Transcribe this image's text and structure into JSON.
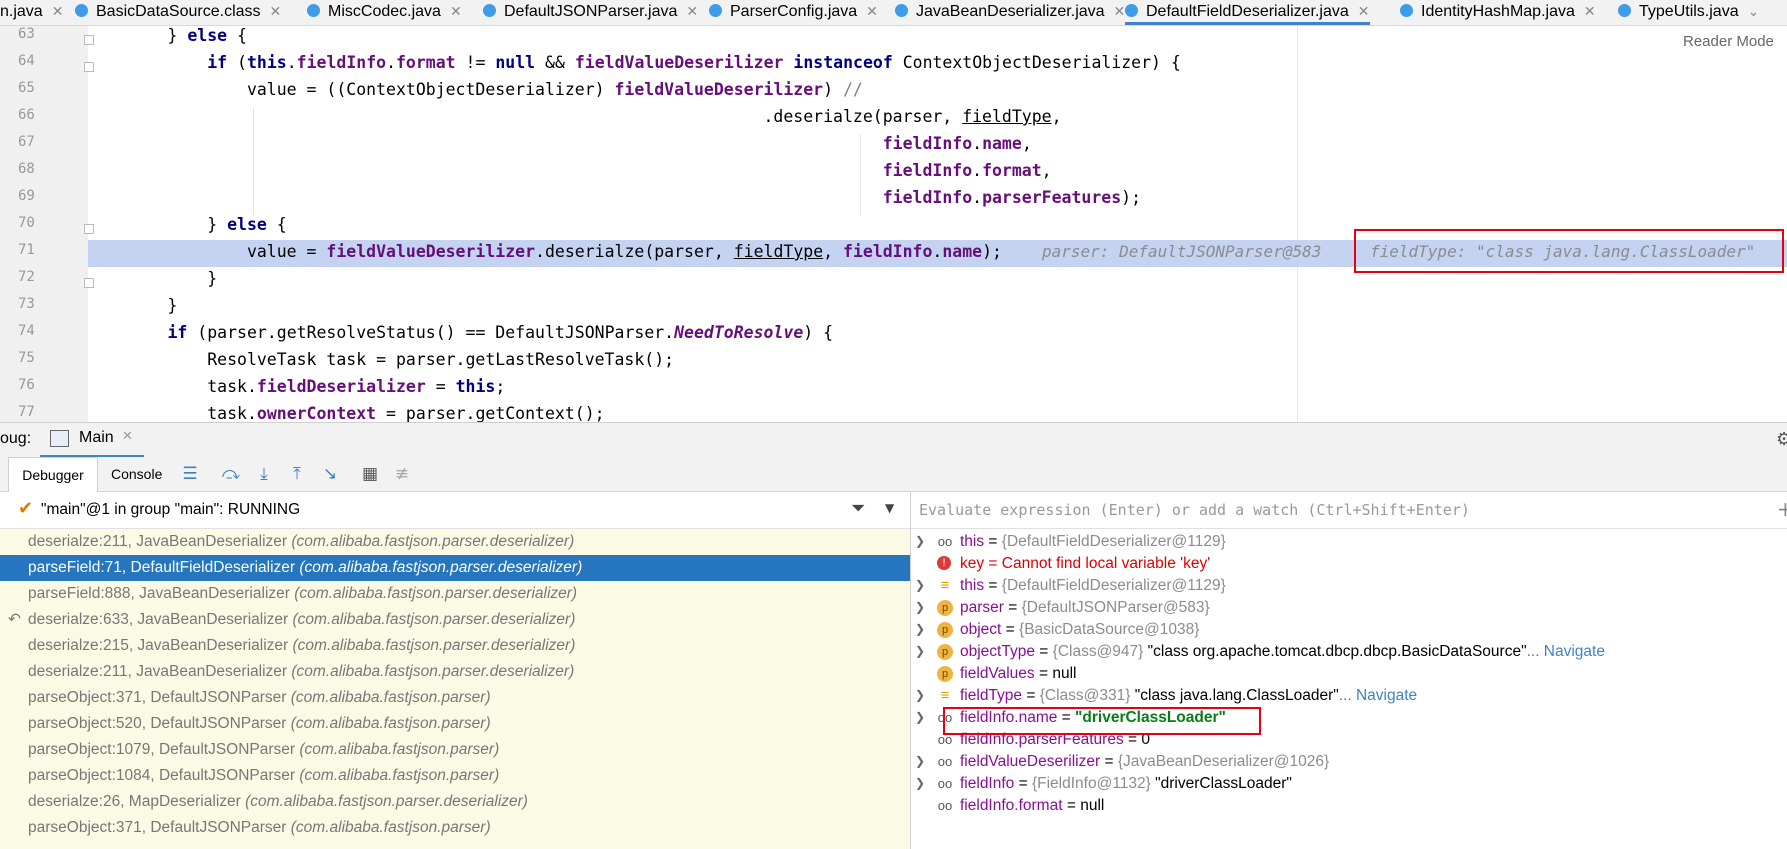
{
  "tabs": [
    {
      "label": "n.java"
    },
    {
      "label": "BasicDataSource.class"
    },
    {
      "label": "MiscCodec.java"
    },
    {
      "label": "DefaultJSONParser.java"
    },
    {
      "label": "ParserConfig.java"
    },
    {
      "label": "JavaBeanDeserializer.java"
    },
    {
      "label": "DefaultFieldDeserializer.java"
    },
    {
      "label": "IdentityHashMap.java"
    },
    {
      "label": "TypeUtils.java"
    }
  ],
  "reader_mode": "Reader Mode",
  "editor": {
    "line_numbers": [
      "63",
      "64",
      "65",
      "66",
      "67",
      "68",
      "69",
      "70",
      "71",
      "72",
      "73",
      "74",
      "75",
      "76",
      "77"
    ],
    "inline_hint_parser": "parser: DefaultJSONParser@583",
    "inline_hint_fieldtype": "fieldType: \"class java.lang.ClassLoader\""
  },
  "debug": {
    "label": "oug:",
    "session_tab": "Main",
    "debugger_tab": "Debugger",
    "console_tab": "Console",
    "thread_status": "\"main\"@1 in group \"main\": RUNNING",
    "eval_placeholder": "Evaluate expression (Enter) or add a watch (Ctrl+Shift+Enter)"
  },
  "frames": [
    {
      "method": "deserialze:211, JavaBeanDeserializer",
      "pkg": "(com.alibaba.fastjson.parser.deserializer)"
    },
    {
      "method": "parseField:71, DefaultFieldDeserializer",
      "pkg": "(com.alibaba.fastjson.parser.deserializer)"
    },
    {
      "method": "parseField:888, JavaBeanDeserializer",
      "pkg": "(com.alibaba.fastjson.parser.deserializer)"
    },
    {
      "method": "deserialze:633, JavaBeanDeserializer",
      "pkg": "(com.alibaba.fastjson.parser.deserializer)"
    },
    {
      "method": "deserialze:215, JavaBeanDeserializer",
      "pkg": "(com.alibaba.fastjson.parser.deserializer)"
    },
    {
      "method": "deserialze:211, JavaBeanDeserializer",
      "pkg": "(com.alibaba.fastjson.parser.deserializer)"
    },
    {
      "method": "parseObject:371, DefaultJSONParser",
      "pkg": "(com.alibaba.fastjson.parser)"
    },
    {
      "method": "parseObject:520, DefaultJSONParser",
      "pkg": "(com.alibaba.fastjson.parser)"
    },
    {
      "method": "parseObject:1079, DefaultJSONParser",
      "pkg": "(com.alibaba.fastjson.parser)"
    },
    {
      "method": "parseObject:1084, DefaultJSONParser",
      "pkg": "(com.alibaba.fastjson.parser)"
    },
    {
      "method": "deserialze:26, MapDeserializer",
      "pkg": "(com.alibaba.fastjson.parser.deserializer)"
    },
    {
      "method": "parseObject:371, DefaultJSONParser",
      "pkg": "(com.alibaba.fastjson.parser)"
    }
  ],
  "variables": [
    {
      "name": "this",
      "eq": " = ",
      "type": "{DefaultFieldDeserializer@1129}",
      "val": "",
      "nav": ""
    },
    {
      "name": "key",
      "eq": " = ",
      "type": "",
      "val": "Cannot find local variable 'key'",
      "nav": ""
    },
    {
      "name": "this",
      "eq": " = ",
      "type": "{DefaultFieldDeserializer@1129}",
      "val": "",
      "nav": ""
    },
    {
      "name": "parser",
      "eq": " = ",
      "type": "{DefaultJSONParser@583}",
      "val": "",
      "nav": ""
    },
    {
      "name": "object",
      "eq": " = ",
      "type": "{BasicDataSource@1038}",
      "val": "",
      "nav": ""
    },
    {
      "name": "objectType",
      "eq": " = ",
      "type": "{Class@947}",
      "val": " \"class org.apache.tomcat.dbcp.dbcp.BasicDataSource\"",
      "nav": "... Navigate"
    },
    {
      "name": "fieldValues",
      "eq": " = ",
      "type": "",
      "val": "null",
      "nav": ""
    },
    {
      "name": "fieldType",
      "eq": " = ",
      "type": "{Class@331}",
      "val": " \"class java.lang.ClassLoader\"",
      "nav": "... Navigate"
    },
    {
      "name": "fieldInfo.name",
      "eq": " = ",
      "type": "",
      "val": "\"driverClassLoader\"",
      "nav": ""
    },
    {
      "name": "fieldInfo.parserFeatures",
      "eq": " = ",
      "type": "",
      "val": "0",
      "nav": ""
    },
    {
      "name": "fieldValueDeserilizer",
      "eq": " = ",
      "type": "{JavaBeanDeserializer@1026}",
      "val": "",
      "nav": ""
    },
    {
      "name": "fieldInfo",
      "eq": " = ",
      "type": "{FieldInfo@1132}",
      "val": " \"driverClassLoader\"",
      "nav": ""
    },
    {
      "name": "fieldInfo.format",
      "eq": " = ",
      "type": "",
      "val": "null",
      "nav": ""
    }
  ]
}
